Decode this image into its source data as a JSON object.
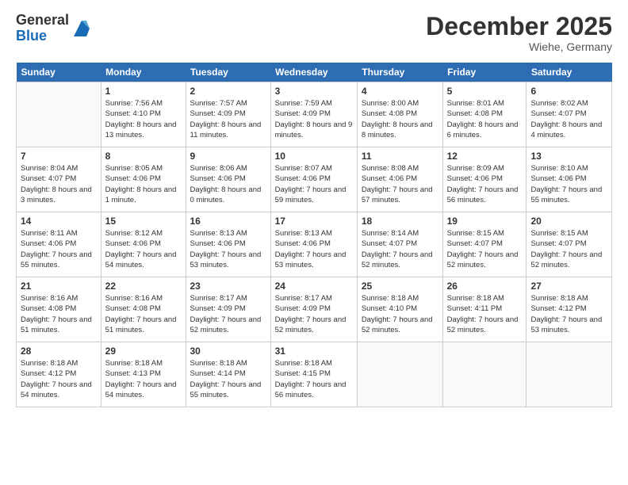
{
  "header": {
    "logo_general": "General",
    "logo_blue": "Blue",
    "month_title": "December 2025",
    "location": "Wiehe, Germany"
  },
  "days_of_week": [
    "Sunday",
    "Monday",
    "Tuesday",
    "Wednesday",
    "Thursday",
    "Friday",
    "Saturday"
  ],
  "weeks": [
    [
      {
        "num": "",
        "empty": true
      },
      {
        "num": "1",
        "sunrise": "Sunrise: 7:56 AM",
        "sunset": "Sunset: 4:10 PM",
        "daylight": "Daylight: 8 hours and 13 minutes."
      },
      {
        "num": "2",
        "sunrise": "Sunrise: 7:57 AM",
        "sunset": "Sunset: 4:09 PM",
        "daylight": "Daylight: 8 hours and 11 minutes."
      },
      {
        "num": "3",
        "sunrise": "Sunrise: 7:59 AM",
        "sunset": "Sunset: 4:09 PM",
        "daylight": "Daylight: 8 hours and 9 minutes."
      },
      {
        "num": "4",
        "sunrise": "Sunrise: 8:00 AM",
        "sunset": "Sunset: 4:08 PM",
        "daylight": "Daylight: 8 hours and 8 minutes."
      },
      {
        "num": "5",
        "sunrise": "Sunrise: 8:01 AM",
        "sunset": "Sunset: 4:08 PM",
        "daylight": "Daylight: 8 hours and 6 minutes."
      },
      {
        "num": "6",
        "sunrise": "Sunrise: 8:02 AM",
        "sunset": "Sunset: 4:07 PM",
        "daylight": "Daylight: 8 hours and 4 minutes."
      }
    ],
    [
      {
        "num": "7",
        "sunrise": "Sunrise: 8:04 AM",
        "sunset": "Sunset: 4:07 PM",
        "daylight": "Daylight: 8 hours and 3 minutes."
      },
      {
        "num": "8",
        "sunrise": "Sunrise: 8:05 AM",
        "sunset": "Sunset: 4:06 PM",
        "daylight": "Daylight: 8 hours and 1 minute."
      },
      {
        "num": "9",
        "sunrise": "Sunrise: 8:06 AM",
        "sunset": "Sunset: 4:06 PM",
        "daylight": "Daylight: 8 hours and 0 minutes."
      },
      {
        "num": "10",
        "sunrise": "Sunrise: 8:07 AM",
        "sunset": "Sunset: 4:06 PM",
        "daylight": "Daylight: 7 hours and 59 minutes."
      },
      {
        "num": "11",
        "sunrise": "Sunrise: 8:08 AM",
        "sunset": "Sunset: 4:06 PM",
        "daylight": "Daylight: 7 hours and 57 minutes."
      },
      {
        "num": "12",
        "sunrise": "Sunrise: 8:09 AM",
        "sunset": "Sunset: 4:06 PM",
        "daylight": "Daylight: 7 hours and 56 minutes."
      },
      {
        "num": "13",
        "sunrise": "Sunrise: 8:10 AM",
        "sunset": "Sunset: 4:06 PM",
        "daylight": "Daylight: 7 hours and 55 minutes."
      }
    ],
    [
      {
        "num": "14",
        "sunrise": "Sunrise: 8:11 AM",
        "sunset": "Sunset: 4:06 PM",
        "daylight": "Daylight: 7 hours and 55 minutes."
      },
      {
        "num": "15",
        "sunrise": "Sunrise: 8:12 AM",
        "sunset": "Sunset: 4:06 PM",
        "daylight": "Daylight: 7 hours and 54 minutes."
      },
      {
        "num": "16",
        "sunrise": "Sunrise: 8:13 AM",
        "sunset": "Sunset: 4:06 PM",
        "daylight": "Daylight: 7 hours and 53 minutes."
      },
      {
        "num": "17",
        "sunrise": "Sunrise: 8:13 AM",
        "sunset": "Sunset: 4:06 PM",
        "daylight": "Daylight: 7 hours and 53 minutes."
      },
      {
        "num": "18",
        "sunrise": "Sunrise: 8:14 AM",
        "sunset": "Sunset: 4:07 PM",
        "daylight": "Daylight: 7 hours and 52 minutes."
      },
      {
        "num": "19",
        "sunrise": "Sunrise: 8:15 AM",
        "sunset": "Sunset: 4:07 PM",
        "daylight": "Daylight: 7 hours and 52 minutes."
      },
      {
        "num": "20",
        "sunrise": "Sunrise: 8:15 AM",
        "sunset": "Sunset: 4:07 PM",
        "daylight": "Daylight: 7 hours and 52 minutes."
      }
    ],
    [
      {
        "num": "21",
        "sunrise": "Sunrise: 8:16 AM",
        "sunset": "Sunset: 4:08 PM",
        "daylight": "Daylight: 7 hours and 51 minutes."
      },
      {
        "num": "22",
        "sunrise": "Sunrise: 8:16 AM",
        "sunset": "Sunset: 4:08 PM",
        "daylight": "Daylight: 7 hours and 51 minutes."
      },
      {
        "num": "23",
        "sunrise": "Sunrise: 8:17 AM",
        "sunset": "Sunset: 4:09 PM",
        "daylight": "Daylight: 7 hours and 52 minutes."
      },
      {
        "num": "24",
        "sunrise": "Sunrise: 8:17 AM",
        "sunset": "Sunset: 4:09 PM",
        "daylight": "Daylight: 7 hours and 52 minutes."
      },
      {
        "num": "25",
        "sunrise": "Sunrise: 8:18 AM",
        "sunset": "Sunset: 4:10 PM",
        "daylight": "Daylight: 7 hours and 52 minutes."
      },
      {
        "num": "26",
        "sunrise": "Sunrise: 8:18 AM",
        "sunset": "Sunset: 4:11 PM",
        "daylight": "Daylight: 7 hours and 52 minutes."
      },
      {
        "num": "27",
        "sunrise": "Sunrise: 8:18 AM",
        "sunset": "Sunset: 4:12 PM",
        "daylight": "Daylight: 7 hours and 53 minutes."
      }
    ],
    [
      {
        "num": "28",
        "sunrise": "Sunrise: 8:18 AM",
        "sunset": "Sunset: 4:12 PM",
        "daylight": "Daylight: 7 hours and 54 minutes."
      },
      {
        "num": "29",
        "sunrise": "Sunrise: 8:18 AM",
        "sunset": "Sunset: 4:13 PM",
        "daylight": "Daylight: 7 hours and 54 minutes."
      },
      {
        "num": "30",
        "sunrise": "Sunrise: 8:18 AM",
        "sunset": "Sunset: 4:14 PM",
        "daylight": "Daylight: 7 hours and 55 minutes."
      },
      {
        "num": "31",
        "sunrise": "Sunrise: 8:18 AM",
        "sunset": "Sunset: 4:15 PM",
        "daylight": "Daylight: 7 hours and 56 minutes."
      },
      {
        "num": "",
        "empty": true
      },
      {
        "num": "",
        "empty": true
      },
      {
        "num": "",
        "empty": true
      }
    ]
  ]
}
